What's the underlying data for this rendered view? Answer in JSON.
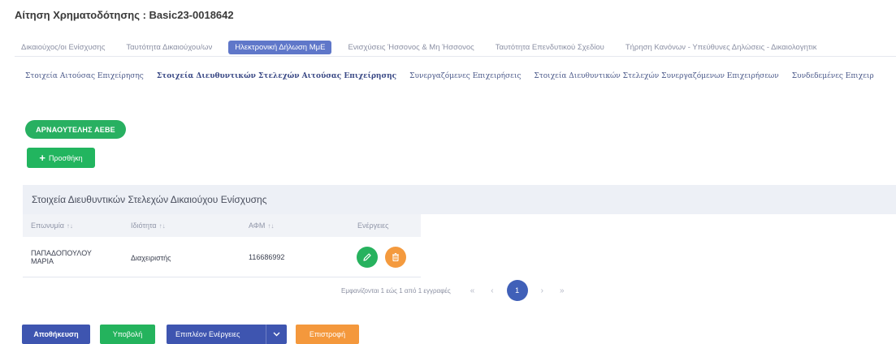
{
  "page": {
    "title": "Αίτηση Χρηματοδότησης : Basic23-0018642"
  },
  "tabs_primary": [
    {
      "label": "Δικαιούχος/οι Ενίσχυσης",
      "active": false
    },
    {
      "label": "Ταυτότητα Δικαιούχου/ων",
      "active": false
    },
    {
      "label": "Ηλεκτρονική Δήλωση ΜμΕ",
      "active": true
    },
    {
      "label": "Ενισχύσεις Ήσσονος & Μη Ήσσονος",
      "active": false
    },
    {
      "label": "Ταυτότητα Επενδυτικού Σχεδίου",
      "active": false
    },
    {
      "label": "Τήρηση Κανόνων - Υπεύθυνες Δηλώσεις - Δικαιολογητικ",
      "active": false
    }
  ],
  "tabs_secondary": [
    {
      "label": "Στοιχεία Αιτούσας Επιχείρησης",
      "active": false
    },
    {
      "label": "Στοιχεία Διευθυντικών Στελεχών Αιτούσας Επιχείρησης",
      "active": true
    },
    {
      "label": "Συνεργαζόμενες Επιχειρήσεις",
      "active": false
    },
    {
      "label": "Στοιχεία Διευθυντικών Στελεχών Συνεργαζόμενων Επιχειρήσεων",
      "active": false
    },
    {
      "label": "Συνδεδεμένες Επιχειρ",
      "active": false
    }
  ],
  "company_button": {
    "label": "ΑΡΝΑΟΥΤΕΛΗΣ ΑΕΒΕ"
  },
  "add_button": {
    "label": "Προσθήκη",
    "icon": "plus-icon"
  },
  "table": {
    "title": "Στοιχεία Διευθυντικών Στελεχών Δικαιούχου Ενίσχυσης",
    "columns": [
      {
        "label": "Επωνυμία",
        "sort_icon": "↑↓"
      },
      {
        "label": "Ιδιότητα",
        "sort_icon": "↑↓"
      },
      {
        "label": "ΑΦΜ",
        "sort_icon": "↑↓"
      },
      {
        "label": "Ενέργειες",
        "sort_icon": ""
      }
    ],
    "rows": [
      {
        "name": "ΠΑΠΑΔΟΠΟΥΛΟΥ ΜΑΡΙΑ",
        "role": "Διαχειριστής",
        "afm": "116686992",
        "actions": [
          "pencil-icon",
          "trash-icon"
        ]
      }
    ]
  },
  "pagination": {
    "info": "Εμφανίζονται 1 εώς 1 από 1 εγγραφές",
    "first": "«",
    "prev": "‹",
    "current": "1",
    "next": "›",
    "last": "»"
  },
  "footer": {
    "save_label": "Αποθήκευση",
    "submit_label": "Υποβολή",
    "more_label": "Επιπλέον Ενέργειες",
    "back_label": "Επιστροφή"
  },
  "colors": {
    "primary": "#3e55b0",
    "success": "#24b35d",
    "warning": "#f4983c",
    "tab_active": "#5f77c9"
  }
}
